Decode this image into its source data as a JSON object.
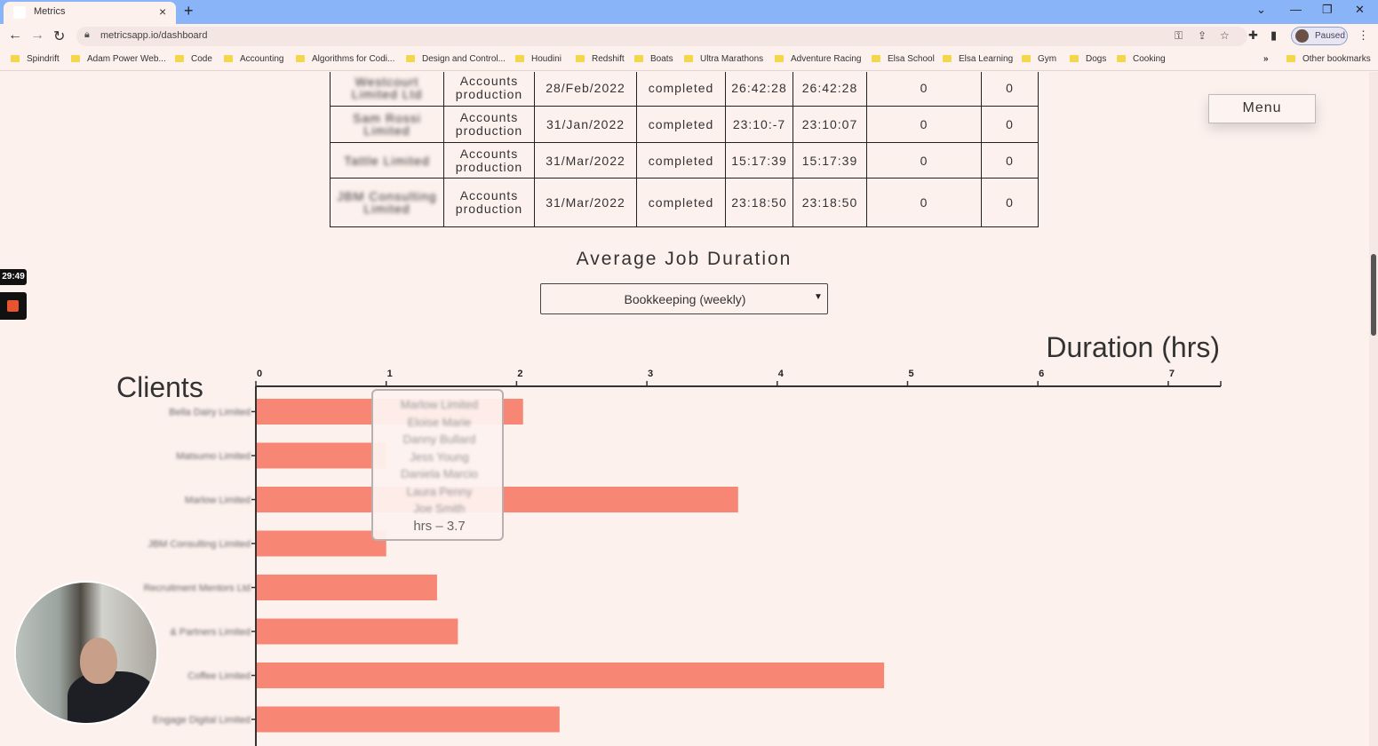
{
  "browser": {
    "tab_title": "Metrics",
    "url": "metricsapp.io/dashboard",
    "profile_label": "Paused",
    "bookmarks": [
      "Spindrift",
      "Adam Power Web...",
      "Code",
      "Accounting",
      "Algorithms for Codi...",
      "Design and Control...",
      "Houdini",
      "Redshift",
      "Boats",
      "Ultra Marathons",
      "Adventure Racing",
      "Elsa School",
      "Elsa Learning",
      "Gym",
      "Dogs",
      "Cooking"
    ],
    "other_bookmarks": "Other bookmarks"
  },
  "recording": {
    "timer": "29:49"
  },
  "menu": {
    "label": "Menu"
  },
  "jobs_table": {
    "rows": [
      {
        "client": "Westcourt Limited Ltd",
        "category": "Accounts production",
        "date": "28/Feb/2022",
        "status": "completed",
        "duration": "26:42:28",
        "time": "26:42:28",
        "col7": "0",
        "col8": "0"
      },
      {
        "client": "Sam Rossi Limited",
        "category": "Accounts production",
        "date": "31/Jan/2022",
        "status": "completed",
        "duration": "23:10:-7",
        "time": "23:10:07",
        "col7": "0",
        "col8": "0"
      },
      {
        "client": "Tattle Limited",
        "category": "Accounts production",
        "date": "31/Mar/2022",
        "status": "completed",
        "duration": "15:17:39",
        "time": "15:17:39",
        "col7": "0",
        "col8": "0"
      },
      {
        "client": "JBM Consulting Limited",
        "category": "Accounts production",
        "date": "31/Mar/2022",
        "status": "completed",
        "duration": "23:18:50",
        "time": "23:18:50",
        "col7": "0",
        "col8": "0"
      }
    ]
  },
  "average_job_duration": {
    "title": "Average Job Duration",
    "selected_option": "Bookkeeping (weekly)"
  },
  "chart_data": {
    "type": "bar",
    "orientation": "horizontal",
    "xlabel": "Duration (hrs)",
    "ylabel": "Clients",
    "xlim": [
      0,
      7.4
    ],
    "x_ticks": [
      0,
      1,
      2,
      3,
      4,
      5,
      6,
      7
    ],
    "categories": [
      "Bella Dairy Limited",
      "Matsumo Limited",
      "Marlow Limited",
      "JBM Consulting Limited",
      "Recruitment Mentors Ltd",
      "& Partners Limited",
      "Coffee Limited",
      "Engage Digital Limited"
    ],
    "values": [
      2.05,
      1.0,
      3.7,
      1.0,
      1.39,
      1.55,
      4.82,
      2.33
    ],
    "bar_color": "#f88675",
    "grid": false
  },
  "tooltip": {
    "names": [
      "Marlow Limited",
      "Eloise Marie",
      "Danny Bullard",
      "Jess Young",
      "Daniela Marcio",
      "Laura Penny",
      "Joe Smith"
    ],
    "hrs_text": "hrs – 3.7"
  }
}
